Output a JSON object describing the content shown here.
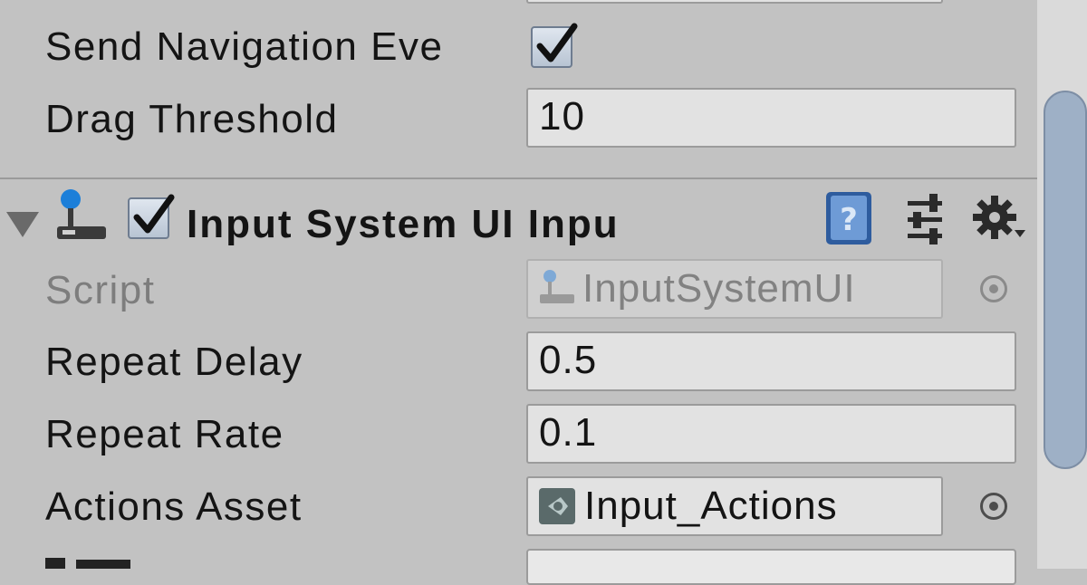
{
  "event_system": {
    "send_navigation_events": {
      "label": "Send Navigation Eve",
      "checked": true
    },
    "drag_threshold": {
      "label": "Drag Threshold",
      "value": "10"
    }
  },
  "component": {
    "title": "Input System UI Inpu",
    "enabled": true,
    "icons": {
      "component": "joystick-icon",
      "help": "help-book-icon",
      "presets": "presets-sliders-icon",
      "settings": "gear-icon"
    }
  },
  "fields": {
    "script": {
      "label": "Script",
      "value": "InputSystemUI"
    },
    "repeat_delay": {
      "label": "Repeat Delay",
      "value": "0.5"
    },
    "repeat_rate": {
      "label": "Repeat Rate",
      "value": "0.1"
    },
    "actions_asset": {
      "label": "Actions Asset",
      "value": "Input_Actions"
    }
  },
  "colors": {
    "panel_bg": "#c2c2c2",
    "field_bg": "#e2e2e2",
    "scroll_thumb": "#9eb0c6"
  }
}
